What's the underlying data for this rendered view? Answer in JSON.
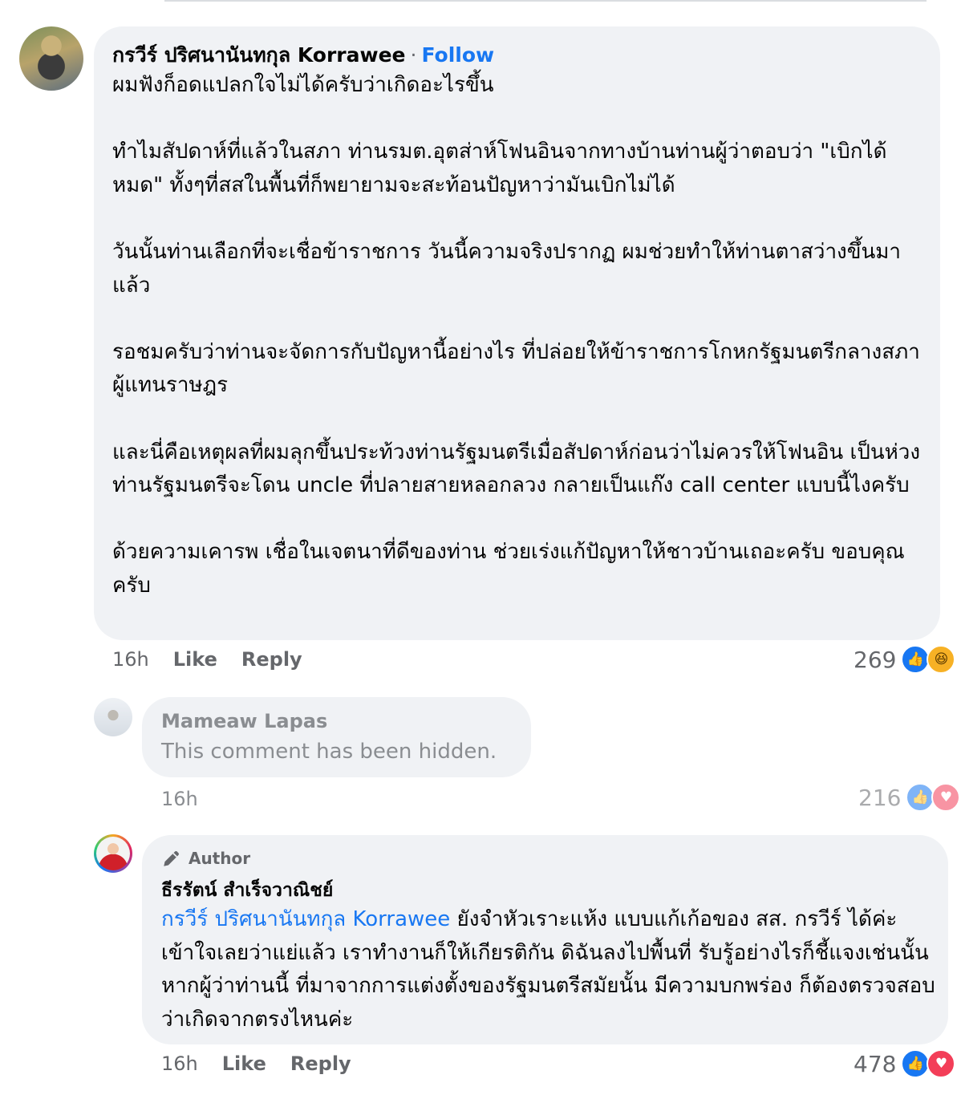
{
  "comment1": {
    "author": "กรวีร์ ปริศนานันทกุล Korrawee",
    "separator": "·",
    "follow_label": "Follow",
    "paragraphs": [
      "ผมฟังก็อดแปลกใจไม่ได้ครับว่าเกิดอะไรขึ้น",
      "ทำไมสัปดาห์ที่แล้วในสภา ท่านรมต.อุตส่าห์โฟนอินจากทางบ้านท่านผู้ว่าตอบว่า \"เบิกได้หมด\" ทั้งๆที่สสในพื้นที่ก็พยายามจะสะท้อนปัญหาว่ามันเบิกไม่ได้",
      "วันนั้นท่านเลือกที่จะเชื่อข้าราชการ วันนี้ความจริงปรากฏ ผมช่วยทำให้ท่านตาสว่างขึ้นมาแล้ว",
      "รอชมครับว่าท่านจะจัดการกับปัญหานี้อย่างไร ที่ปล่อยให้ข้าราชการโกหกรัฐมนตรีกลางสภาผู้แทนราษฎร",
      "และนี่คือเหตุผลที่ผมลุกขึ้นประท้วงท่านรัฐมนตรีเมื่อสัปดาห์ก่อนว่าไม่ควรให้โฟนอิน เป็นห่วงท่านรัฐมนตรีจะโดน uncle ที่ปลายสายหลอกลวง กลายเป็นแก๊ง call center แบบนี้ไงครับ",
      "ด้วยความเคารพ เชื่อในเจตนาที่ดีของท่าน ช่วยเร่งแก้ปัญหาให้ชาวบ้านเถอะครับ ขอบคุณครับ"
    ],
    "time": "16h",
    "like_label": "Like",
    "reply_label": "Reply",
    "reaction_count": "269",
    "reaction_icons": [
      "like-icon",
      "haha-icon"
    ]
  },
  "comment2": {
    "author": "Mameaw Lapas",
    "text": "This comment has been hidden.",
    "time": "16h",
    "reaction_count": "216",
    "reaction_icons": [
      "like-icon",
      "love-icon"
    ]
  },
  "comment3": {
    "badge": "Author",
    "author": "ธีรรัตน์ สำเร็จวาณิชย์",
    "mention": "กรวีร์ ปริศนานันทกุล Korrawee",
    "text": " ยังจำหัวเราะแห้ง แบบแก้เก้อของ สส. กรวีร์ ได้ค่ะ เข้าใจเลยว่าแย่แล้ว เราทำงานก็ให้เกียรติกัน ดิฉันลงไปพื้นที่ รับรู้อย่างไรก็ชี้แจงเช่นนั้น หากผู้ว่าท่านนี้ ที่มาจากการแต่งตั้งของรัฐมนตรีสมัยนั้น มีความบกพร่อง ก็ต้องตรวจสอบว่าเกิดจากตรงไหนค่ะ",
    "time": "16h",
    "like_label": "Like",
    "reply_label": "Reply",
    "reaction_count": "478",
    "reaction_icons": [
      "like-icon",
      "love-icon"
    ]
  },
  "colors": {
    "bubble": "#f0f2f5",
    "link": "#1877f2",
    "meta": "#65676b",
    "hidden": "#8a8d91"
  }
}
